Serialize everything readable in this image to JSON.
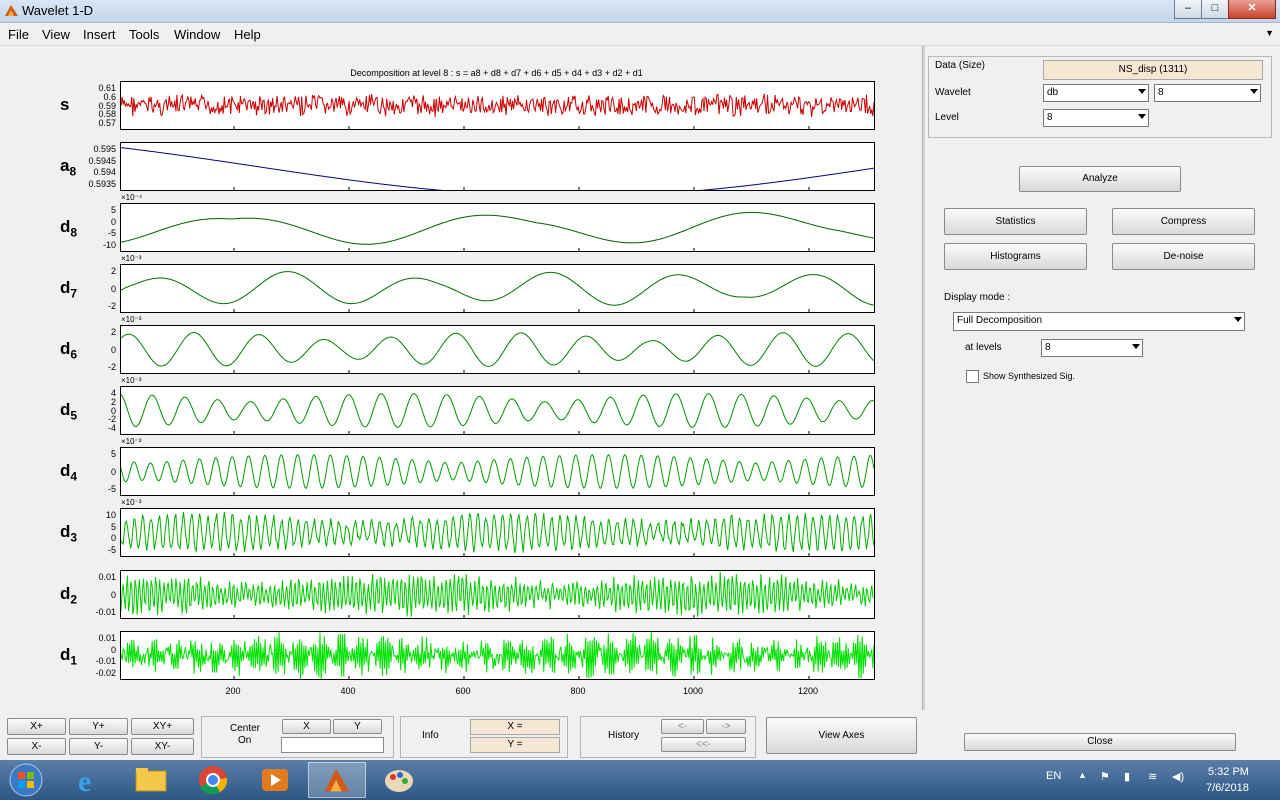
{
  "window": {
    "title": "Wavelet 1-D",
    "min": "–",
    "max": "□",
    "close": "✕"
  },
  "menu": [
    "File",
    "View",
    "Insert",
    "Tools",
    "Window",
    "Help"
  ],
  "plot": {
    "title": "Decomposition at level 8 : s = a8 + d8 + d7 + d6 + d5 + d4 + d3 + d2 + d1",
    "xticks": [
      "200",
      "400",
      "600",
      "800",
      "1000",
      "1200"
    ]
  },
  "rows": [
    {
      "name": "s",
      "sub": "",
      "exp": "",
      "ticks": [
        "0.61",
        "0.6",
        "0.59",
        "0.58",
        "0.57"
      ],
      "color": "#cc0000"
    },
    {
      "name": "a",
      "sub": "8",
      "exp": "",
      "ticks": [
        "0.595",
        "0.5945",
        "0.594",
        "0.5935"
      ],
      "color": "#000080"
    },
    {
      "name": "d",
      "sub": "8",
      "exp": "×10⁻⁴",
      "ticks": [
        "5",
        "0",
        "-5",
        "-10"
      ],
      "color": "#006000"
    },
    {
      "name": "d",
      "sub": "7",
      "exp": "×10⁻³",
      "ticks": [
        "2",
        "0",
        "-2"
      ],
      "color": "#007000"
    },
    {
      "name": "d",
      "sub": "6",
      "exp": "×10⁻³",
      "ticks": [
        "2",
        "0",
        "-2"
      ],
      "color": "#008000"
    },
    {
      "name": "d",
      "sub": "5",
      "exp": "×10⁻³",
      "ticks": [
        "4",
        "2",
        "0",
        "-2",
        "-4"
      ],
      "color": "#009000"
    },
    {
      "name": "d",
      "sub": "4",
      "exp": "×10⁻³",
      "ticks": [
        "5",
        "0",
        "-5"
      ],
      "color": "#00a000"
    },
    {
      "name": "d",
      "sub": "3",
      "exp": "×10⁻³",
      "ticks": [
        "10",
        "5",
        "0",
        "-5"
      ],
      "color": "#00b000"
    },
    {
      "name": "d",
      "sub": "2",
      "exp": "",
      "ticks": [
        "0.01",
        "0",
        "-0.01"
      ],
      "color": "#00cc00"
    },
    {
      "name": "d",
      "sub": "1",
      "exp": "",
      "ticks": [
        "0.01",
        "0",
        "-0.01",
        "-0.02"
      ],
      "color": "#00e000"
    }
  ],
  "panel": {
    "data_label": "Data  (Size)",
    "data_value": "NS_disp  (1311)",
    "wavelet_label": "Wavelet",
    "wavelet_family": "db",
    "wavelet_order": "8",
    "level_label": "Level",
    "level_value": "8",
    "analyze": "Analyze",
    "statistics": "Statistics",
    "compress": "Compress",
    "histograms": "Histograms",
    "denoise": "De-noise",
    "display_mode_label": "Display mode :",
    "display_mode_value": "Full Decomposition",
    "at_levels_label": "at levels",
    "at_levels_value": "8",
    "show_synth": "Show Synthesized Sig.",
    "close": "Close"
  },
  "bottom": {
    "xplus": "X+",
    "yplus": "Y+",
    "xyplus": "XY+",
    "xminus": "X-",
    "yminus": "Y-",
    "xyminus": "XY-",
    "center_on": "Center",
    "center_on2": "On",
    "cx": "X",
    "cy": "Y",
    "info": "Info",
    "info_x": "X =",
    "info_y": "Y =",
    "history": "History",
    "hist_back": "<-",
    "hist_fwd": "->",
    "hist_first": "<<-",
    "view_axes": "View Axes"
  },
  "taskbar": {
    "lang": "EN",
    "time": "5:32 PM",
    "date": "7/6/2018"
  }
}
